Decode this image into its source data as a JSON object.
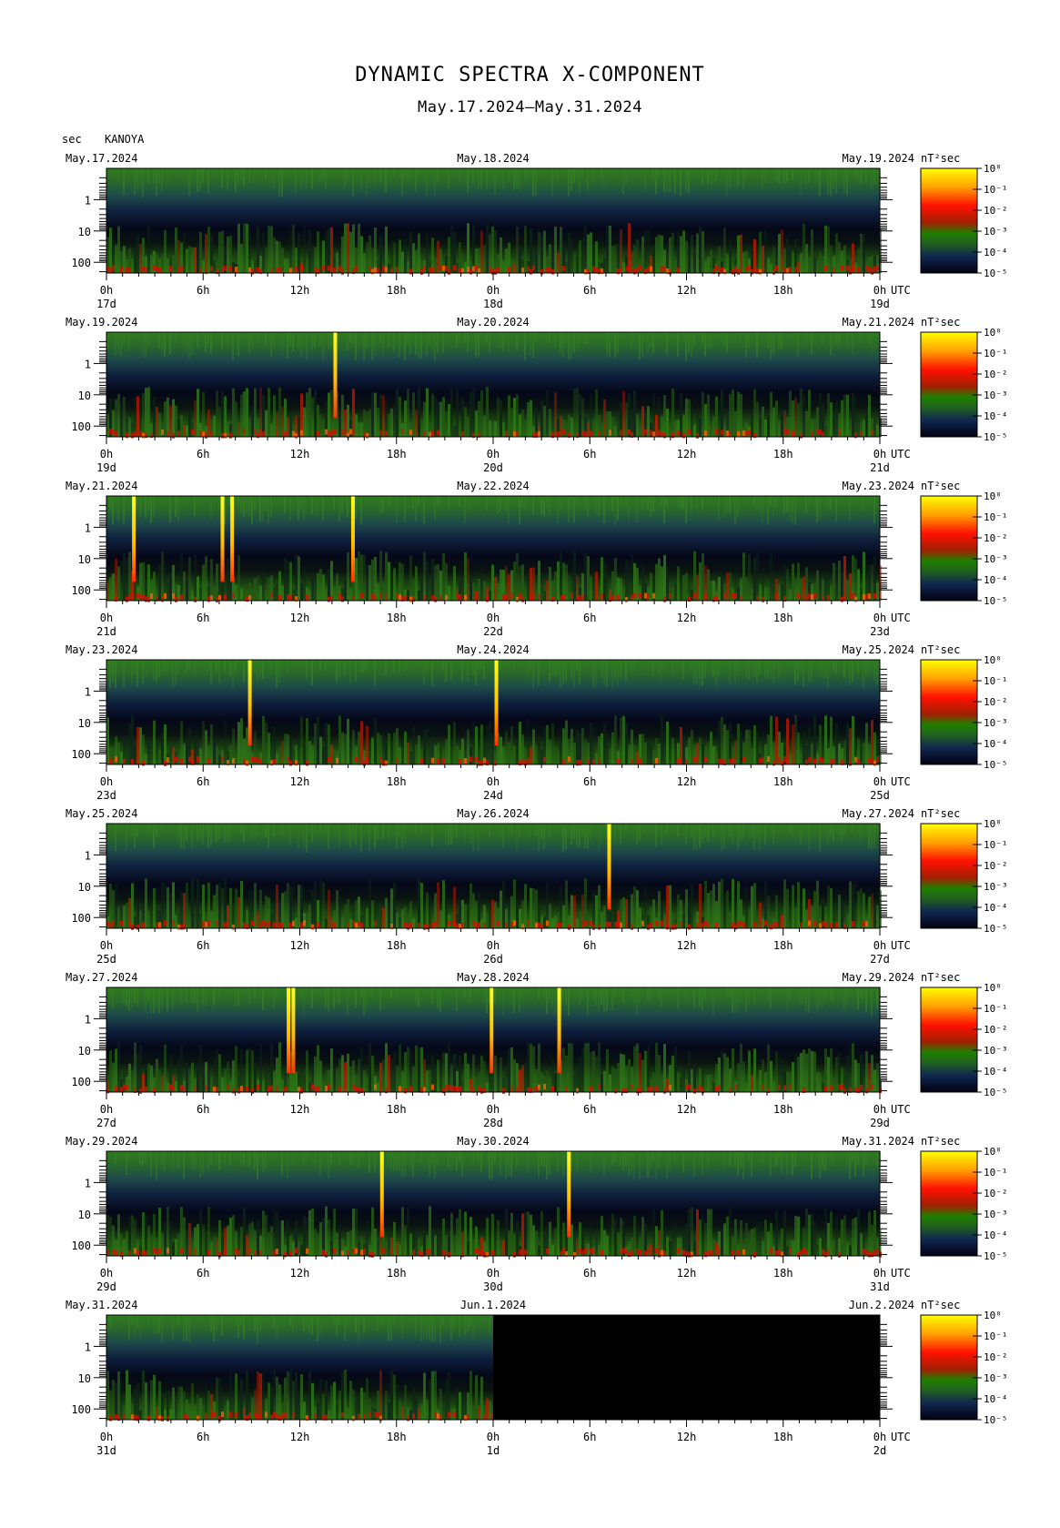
{
  "title": "DYNAMIC SPECTRA X-COMPONENT",
  "subtitle": "May.17.2024–May.31.2024",
  "period_unit": "sec",
  "station": "KANOYA",
  "power_unit": "nT²sec",
  "chart_data": {
    "type": "heatmap",
    "title": "DYNAMIC SPECTRA X-COMPONENT",
    "subtitle": "May.17.2024–May.31.2024",
    "ylabel": "sec",
    "y_scale": "log",
    "y_ticks": [
      "1",
      "10",
      "100"
    ],
    "x_ticks": [
      "0h",
      "6h",
      "12h",
      "18h",
      "0h",
      "6h",
      "12h",
      "18h",
      "0h"
    ],
    "time_zone": "UTC",
    "colorbar": {
      "unit": "nT²sec",
      "scale": "log",
      "ticks": [
        "10⁰",
        "10⁻¹",
        "10⁻²",
        "10⁻³",
        "10⁻⁴",
        "10⁻⁵"
      ],
      "colors": [
        "#ffff00",
        "#ff8000",
        "#ff1000",
        "#206000",
        "#204040",
        "#000010"
      ]
    },
    "panels": [
      {
        "start": "May.17.2024",
        "mid": "May.18.2024",
        "end": "May.19.2024",
        "day_labels": [
          "17d",
          "18d",
          "19d"
        ],
        "bursts": []
      },
      {
        "start": "May.19.2024",
        "mid": "May.20.2024",
        "end": "May.21.2024",
        "day_labels": [
          "19d",
          "20d",
          "21d"
        ],
        "bursts": [
          14.2
        ]
      },
      {
        "start": "May.21.2024",
        "mid": "May.22.2024",
        "end": "May.23.2024",
        "day_labels": [
          "21d",
          "22d",
          "23d"
        ],
        "bursts": [
          1.7,
          7.2,
          7.8,
          15.3
        ]
      },
      {
        "start": "May.23.2024",
        "mid": "May.24.2024",
        "end": "May.25.2024",
        "day_labels": [
          "23d",
          "24d",
          "25d"
        ],
        "bursts": [
          8.9,
          24.2
        ]
      },
      {
        "start": "May.25.2024",
        "mid": "May.26.2024",
        "end": "May.27.2024",
        "day_labels": [
          "25d",
          "26d",
          "27d"
        ],
        "bursts": [
          31.2
        ]
      },
      {
        "start": "May.27.2024",
        "mid": "May.28.2024",
        "end": "May.29.2024",
        "day_labels": [
          "27d",
          "28d",
          "29d"
        ],
        "bursts": [
          11.3,
          11.6,
          23.9,
          28.1
        ]
      },
      {
        "start": "May.29.2024",
        "mid": "May.30.2024",
        "end": "May.31.2024",
        "day_labels": [
          "29d",
          "30d",
          "31d"
        ],
        "bursts": [
          17.1,
          28.7
        ]
      },
      {
        "start": "May.31.2024",
        "mid": "Jun.1.2024",
        "end": "Jun.2.2024",
        "day_labels": [
          "31d",
          "1d",
          "2d"
        ],
        "bursts": [],
        "data_until_h": 24
      }
    ]
  }
}
